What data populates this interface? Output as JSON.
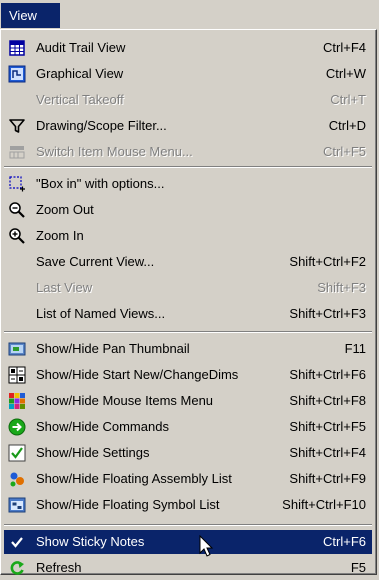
{
  "menubar": {
    "title": "View"
  },
  "menu": {
    "items": [
      {
        "label": "Audit Trail View",
        "shortcut": "Ctrl+F4",
        "icon": "audit-trail-icon",
        "enabled": true
      },
      {
        "label": "Graphical View",
        "shortcut": "Ctrl+W",
        "icon": "graphical-view-icon",
        "enabled": true
      },
      {
        "label": "Vertical Takeoff",
        "shortcut": "Ctrl+T",
        "icon": "",
        "enabled": false
      },
      {
        "label": "Drawing/Scope Filter...",
        "shortcut": "Ctrl+D",
        "icon": "filter-icon",
        "enabled": true
      },
      {
        "label": "Switch Item Mouse Menu...",
        "shortcut": "Ctrl+F5",
        "icon": "mouse-menu-icon",
        "enabled": false
      },
      {
        "label": "\"Box in\" with options...",
        "shortcut": "",
        "icon": "box-in-icon",
        "enabled": true
      },
      {
        "label": "Zoom Out",
        "shortcut": "",
        "icon": "zoom-out-icon",
        "enabled": true
      },
      {
        "label": "Zoom In",
        "shortcut": "",
        "icon": "zoom-in-icon",
        "enabled": true
      },
      {
        "label": "Save Current View...",
        "shortcut": "Shift+Ctrl+F2",
        "icon": "",
        "enabled": true
      },
      {
        "label": "Last View",
        "shortcut": "Shift+F3",
        "icon": "",
        "enabled": false
      },
      {
        "label": "List of Named Views...",
        "shortcut": "Shift+Ctrl+F3",
        "icon": "",
        "enabled": true
      },
      {
        "label": "Show/Hide Pan Thumbnail",
        "shortcut": "F11",
        "icon": "pan-thumbnail-icon",
        "enabled": true
      },
      {
        "label": "Show/Hide Start New/ChangeDims",
        "shortcut": "Shift+Ctrl+F6",
        "icon": "start-new-icon",
        "enabled": true
      },
      {
        "label": "Show/Hide Mouse Items Menu",
        "shortcut": "Shift+Ctrl+F8",
        "icon": "mouse-items-icon",
        "enabled": true
      },
      {
        "label": "Show/Hide Commands",
        "shortcut": "Shift+Ctrl+F5",
        "icon": "commands-icon",
        "enabled": true
      },
      {
        "label": "Show/Hide Settings",
        "shortcut": "Shift+Ctrl+F4",
        "icon": "settings-check-icon",
        "enabled": true
      },
      {
        "label": "Show/Hide Floating Assembly List",
        "shortcut": "Shift+Ctrl+F9",
        "icon": "assembly-list-icon",
        "enabled": true
      },
      {
        "label": "Show/Hide Floating Symbol List",
        "shortcut": "Shift+Ctrl+F10",
        "icon": "symbol-list-icon",
        "enabled": true
      },
      {
        "label": "Show Sticky Notes",
        "shortcut": "Ctrl+F6",
        "icon": "checkmark-icon",
        "enabled": true,
        "selected": true
      },
      {
        "label": "Refresh",
        "shortcut": "F5",
        "icon": "refresh-icon",
        "enabled": true
      }
    ]
  },
  "colors": {
    "menu_background": "#d4d0c8",
    "highlight": "#0a246a",
    "disabled_text": "#808080"
  }
}
